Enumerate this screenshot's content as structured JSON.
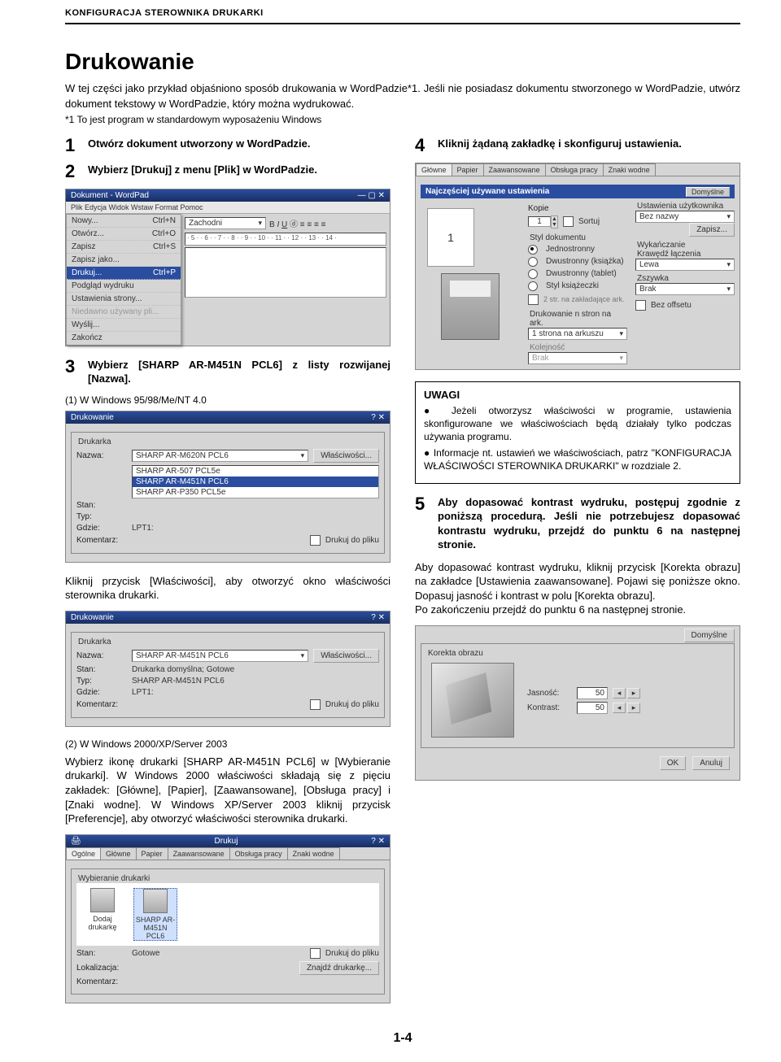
{
  "header": "KONFIGURACJA STEROWNIKA DRUKARKI",
  "title": "Drukowanie",
  "intro": "W tej części jako przykład objaśniono sposób drukowania w WordPadzie*1. Jeśli nie posiadasz dokumentu stworzonego w WordPadzie, utwórz dokument tekstowy w WordPadzie, który można wydrukować.",
  "note": "*1    To jest program w standardowym wyposażeniu Windows",
  "steps": {
    "s1": {
      "num": "1",
      "text": "Otwórz dokument utworzony w WordPadzie."
    },
    "s2": {
      "num": "2",
      "text": "Wybierz [Drukuj] z menu [Plik] w WordPadzie."
    },
    "s3": {
      "num": "3",
      "text": "Wybierz [SHARP AR-M451N PCL6] z listy rozwijanej [Nazwa]."
    },
    "s3sub": "(1)    W Windows 95/98/Me/NT 4.0",
    "s3click": "Kliknij przycisk [Właściwości], aby otworzyć okno właściwości sterownika drukarki.",
    "s3sub2": "(2)    W Windows 2000/XP/Server 2003",
    "s3desc2": "Wybierz ikonę drukarki [SHARP AR-M451N PCL6] w [Wybieranie drukarki]. W Windows 2000 właściwości składają się z pięciu zakładek: [Główne], [Papier], [Zaawansowane], [Obsługa pracy] i [Znaki wodne]. W Windows XP/Server 2003 kliknij przycisk [Preferencje], aby otworzyć właściwości sterownika drukarki.",
    "s4": {
      "num": "4",
      "text": "Kliknij żądaną zakładkę i skonfiguruj ustawienia."
    },
    "s5": {
      "num": "5",
      "text": "Aby dopasować kontrast wydruku, postępuj zgodnie z poniższą procedurą. Jeśli nie potrzebujesz dopasować kontrastu wydruku, przejdź do punktu 6 na następnej stronie."
    },
    "s5body": "Aby dopasować kontrast wydruku, kliknij przycisk [Korekta obrazu] na zakładce [Ustawienia zaawansowane]. Pojawi się poniższe okno. Dopasuj jasność i kontrast w polu [Korekta obrazu].\nPo zakończeniu przejdź do punktu 6 na następnej stronie."
  },
  "uwagi": {
    "title": "UWAGI",
    "items": [
      "Jeżeli otworzysz właściwości w programie, ustawienia skonfigurowane we właściwościach będą działały tylko podczas używania programu.",
      "Informacje nt. ustawień we właściwościach, patrz \"KONFIGURACJA WŁAŚCIWOŚCI STEROWNIKA DRUKARKI\" w rozdziale 2."
    ]
  },
  "wordpad": {
    "title": "Dokument - WordPad",
    "menus": "Plik   Edycja   Widok   Wstaw   Format   Pomoc",
    "items": [
      {
        "label": "Nowy...",
        "sc": "Ctrl+N"
      },
      {
        "label": "Otwórz...",
        "sc": "Ctrl+O"
      },
      {
        "label": "Zapisz",
        "sc": "Ctrl+S"
      },
      {
        "label": "Zapisz jako...",
        "sc": ""
      },
      {
        "label": "Drukuj...",
        "sc": "Ctrl+P",
        "hi": true
      },
      {
        "label": "Podgląd wydruku",
        "sc": ""
      },
      {
        "label": "Ustawienia strony...",
        "sc": ""
      },
      {
        "label": "Wyślij...",
        "sc": ""
      },
      {
        "label": "Zakończ",
        "sc": ""
      }
    ],
    "font": "Zachodni"
  },
  "printdlg1": {
    "title": "Drukowanie",
    "group": "Drukarka",
    "name_lbl": "Nazwa:",
    "selected": "SHARP AR-M620N PCL6",
    "options": [
      "SHARP AR-507 PCL5e",
      "SHARP AR-M451N PCL6",
      "SHARP AR-P350 PCL5e"
    ],
    "stan_lbl": "Stan:",
    "typ_lbl": "Typ:",
    "gdzie_lbl": "Gdzie:",
    "gdzie_val": "LPT1:",
    "kom_lbl": "Komentarz:",
    "props_btn": "Właściwości...",
    "tofile": "Drukuj do pliku"
  },
  "printdlg2": {
    "title": "Drukowanie",
    "group": "Drukarka",
    "name_lbl": "Nazwa:",
    "name_val": "SHARP AR-M451N PCL6",
    "stan_lbl": "Stan:",
    "stan_val": "Drukarka domyślna; Gotowe",
    "typ_lbl": "Typ:",
    "typ_val": "SHARP AR-M451N PCL6",
    "gdzie_lbl": "Gdzie:",
    "gdzie_val": "LPT1:",
    "kom_lbl": "Komentarz:",
    "props_btn": "Właściwości...",
    "tofile": "Drukuj do pliku"
  },
  "printdlg3": {
    "title": "Drukuj",
    "tabs": [
      "Ogólne",
      "Główne",
      "Papier",
      "Zaawansowane",
      "Obsługa pracy",
      "Znaki wodne"
    ],
    "group": "Wybieranie drukarki",
    "icons": [
      {
        "label": "Dodaj drukarkę"
      },
      {
        "label": "SHARP AR-M451N PCL6",
        "sel": true
      }
    ],
    "stan_lbl": "Stan:",
    "stan_val": "Gotowe",
    "lok_lbl": "Lokalizacja:",
    "kom_lbl": "Komentarz:",
    "tofile": "Drukuj do pliku",
    "find_btn": "Znajdź drukarkę..."
  },
  "propsdlg": {
    "tabs": [
      "Główne",
      "Papier",
      "Zaawansowane",
      "Obsługa pracy",
      "Znaki wodne"
    ],
    "banner": "Najczęściej używane ustawienia",
    "banner_btn": "Domyślne",
    "kopie_lbl": "Kopie",
    "kopie_val": "1",
    "ust_lbl": "Ustawienia użytkownika",
    "ust_val": "Bez nazwy",
    "save_btn": "Zapisz...",
    "style_lbl": "Styl dokumentu",
    "style_opts": [
      "Jednostronny",
      "Dwustronny (książka)",
      "Dwustronny (tablet)",
      "Styl książeczki"
    ],
    "fin_lbl": "Wykańczanie",
    "edge_lbl": "Krawędź łączenia",
    "edge_val": "Lewa",
    "zsz_lbl": "Zszywka",
    "zsz_val": "Brak",
    "noff_lbl": "Bez offsetu",
    "nup_lbl": "Drukowanie n stron na ark.",
    "nup_val": "1 strona na arkuszu",
    "sort_chk": "Sortuj"
  },
  "contrast": {
    "default_btn": "Domyślne",
    "group": "Korekta obrazu",
    "bright_lbl": "Jasność:",
    "bright_val": "50",
    "contrast_lbl": "Kontrast:",
    "contrast_val": "50",
    "ok": "OK",
    "cancel": "Anuluj"
  },
  "page_num": "1-4"
}
